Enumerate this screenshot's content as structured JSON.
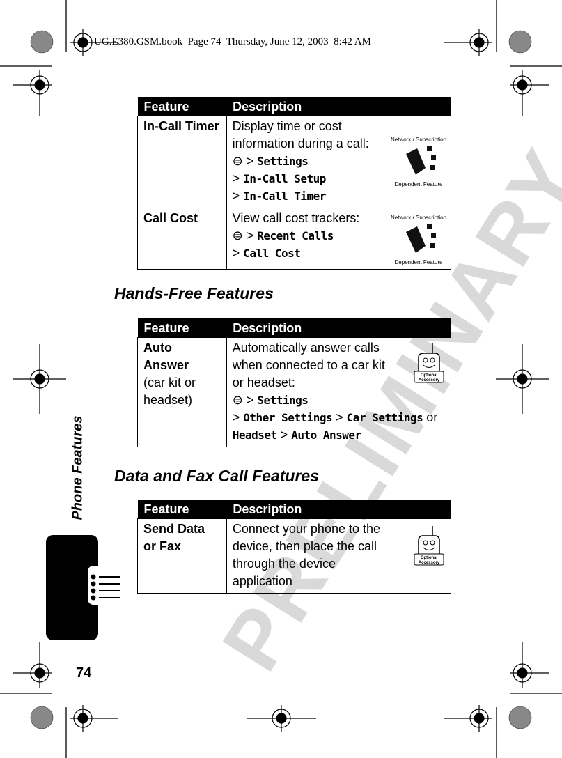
{
  "header": {
    "book_info": "UG.E380.GSM.book  Page 74  Thursday, June 12, 2003  8:42 AM"
  },
  "watermark": "PRELIMINARY",
  "side": {
    "section_label": "Phone Features",
    "page_number": "74"
  },
  "tables": {
    "columns": {
      "feature": "Feature",
      "description": "Description"
    },
    "call_timer": {
      "rows": [
        {
          "feature": "In-Call Timer",
          "description": "Display time or cost information during a call:",
          "path": [
            "Settings",
            "In-Call Setup",
            "In-Call Timer"
          ],
          "badge": "Network / Subscription Dependent Feature"
        },
        {
          "feature": "Call Cost",
          "description": "View call cost trackers:",
          "path": [
            "Recent Calls",
            "Call Cost"
          ],
          "badge": "Network / Subscription Dependent Feature"
        }
      ]
    },
    "hands_free": {
      "title": "Hands-Free Features",
      "rows": [
        {
          "feature": "Auto Answer",
          "feature_note": "(car kit or headset)",
          "description": "Automatically answer calls when connected to a car kit or headset:",
          "path_a": [
            "Settings",
            "Other Settings",
            "Car Settings"
          ],
          "or": "or",
          "path_b": [
            "Headset",
            "Auto Answer"
          ],
          "badge": "Optional Accessory"
        }
      ]
    },
    "data_fax": {
      "title": "Data and Fax Call Features",
      "rows": [
        {
          "feature": "Send Data or Fax",
          "description": "Connect your phone to the device, then place the call through the device application",
          "badge": "Optional Accessory"
        }
      ]
    }
  },
  "icons": {
    "menu_key": "menu-key-icon",
    "separator": ">"
  }
}
